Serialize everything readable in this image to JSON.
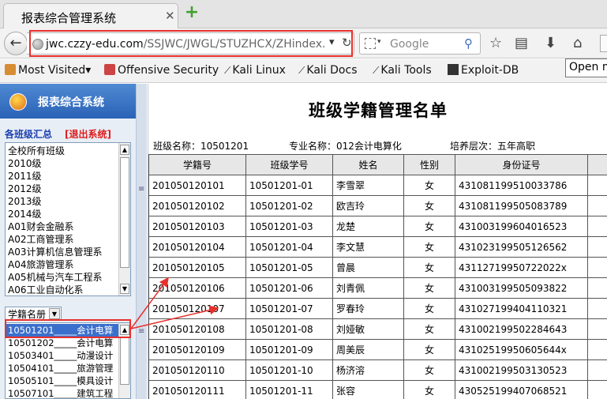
{
  "browser": {
    "tab_title": "报表综合管理系统",
    "tab_close": "✕",
    "new_tab": "+",
    "url_host": "jwc.czzy-edu.com",
    "url_path": "/SSJWC/JWGL/STUZHCX/ZHindex.",
    "search_placeholder": "Google",
    "tooltip": "Open m"
  },
  "bookmarks": [
    {
      "label": "Most Visited",
      "suffix": "▾"
    },
    {
      "label": "Offensive Security"
    },
    {
      "label": "Kali Linux"
    },
    {
      "label": "Kali Docs"
    },
    {
      "label": "Kali Tools"
    },
    {
      "label": "Exploit-DB"
    }
  ],
  "sidebar": {
    "logo_text": "报表综合系统",
    "summary_link": "各班级汇总",
    "logout_link": "[退出系统]",
    "majors": [
      "全校所有班级",
      "2010级",
      "2011级",
      "2012级",
      "2013级",
      "2014级",
      "A01财会金融系",
      "A02工商管理系",
      "A03计算机信息管理系",
      "A04旅游管理系",
      "A05机械与汽车工程系",
      "A06工业自动化系"
    ],
    "category_select": "学籍名册",
    "classes": [
      "10501201_____会计电算",
      "10501202_____会计电算",
      "10503401_____动漫设计",
      "10504101_____旅游管理",
      "10505101_____模具设计",
      "10507101_____建筑工程"
    ],
    "selected_class_index": 0
  },
  "main": {
    "title": "班级学籍管理名单",
    "class_name": "班级名称：10501201",
    "major_name": "专业名称：012会计电算化",
    "level": "培养层次：五年高职",
    "columns": [
      "学籍号",
      "班级学号",
      "姓名",
      "性别",
      "身份证号"
    ],
    "rows": [
      [
        "201050120101",
        "10501201-01",
        "李雪翠",
        "女",
        "431081199510033786"
      ],
      [
        "201050120102",
        "10501201-02",
        "欧吉玲",
        "女",
        "431081199505083789"
      ],
      [
        "201050120103",
        "10501201-03",
        "龙楚",
        "女",
        "431003199604016523"
      ],
      [
        "201050120104",
        "10501201-04",
        "李文慧",
        "女",
        "431023199505126562"
      ],
      [
        "201050120105",
        "10501201-05",
        "曾晨",
        "女",
        "43112719950722022x"
      ],
      [
        "201050120106",
        "10501201-06",
        "刘青佩",
        "女",
        "431003199505093822"
      ],
      [
        "201050120107",
        "10501201-07",
        "罗春玲",
        "女",
        "431027199404110321"
      ],
      [
        "201050120108",
        "10501201-08",
        "刘娅敏",
        "女",
        "431002199502284643"
      ],
      [
        "201050120109",
        "10501201-09",
        "周美辰",
        "女",
        "43102519950605644x"
      ],
      [
        "201050120110",
        "10501201-10",
        "杨济溶",
        "女",
        "431002199503130523"
      ],
      [
        "201050120111",
        "10501201-11",
        "张容",
        "女",
        "430525199407068521"
      ]
    ]
  },
  "annotation_color": "#e8302c"
}
